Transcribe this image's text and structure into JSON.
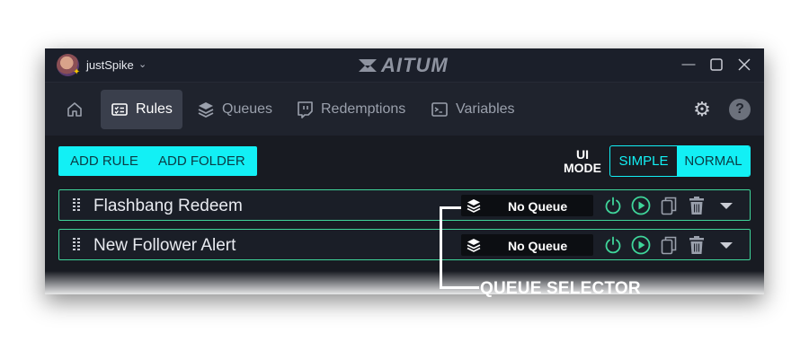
{
  "titlebar": {
    "username": "justSpike",
    "logo_text": "AITUM",
    "window_controls": [
      "minimize-icon",
      "maximize-icon",
      "close-icon"
    ]
  },
  "nav": {
    "items": [
      {
        "label": "",
        "icon": "home-icon"
      },
      {
        "label": "Rules",
        "icon": "rules-icon",
        "active": true
      },
      {
        "label": "Queues",
        "icon": "layers-icon"
      },
      {
        "label": "Redemptions",
        "icon": "twitch-icon"
      },
      {
        "label": "Variables",
        "icon": "terminal-icon"
      }
    ],
    "settings_icon": "gear-icon",
    "help_label": "?"
  },
  "toolbar": {
    "add_rule_label": "ADD RULE",
    "add_folder_label": "ADD FOLDER",
    "ui_mode_label_1": "UI",
    "ui_mode_label_2": "MODE",
    "mode_simple_label": "SIMPLE",
    "mode_normal_label": "NORMAL",
    "selected_mode": "NORMAL"
  },
  "rules": [
    {
      "name": "Flashbang Redeem",
      "queue": "No Queue"
    },
    {
      "name": "New Follower Alert",
      "queue": "No Queue"
    }
  ],
  "annotation": {
    "label": "QUEUE SELECTOR"
  },
  "colors": {
    "accent": "#12f0f5",
    "rule_border": "#3fd59a",
    "row_icon_green": "#3fd59a",
    "window_bg": "#181b22"
  }
}
